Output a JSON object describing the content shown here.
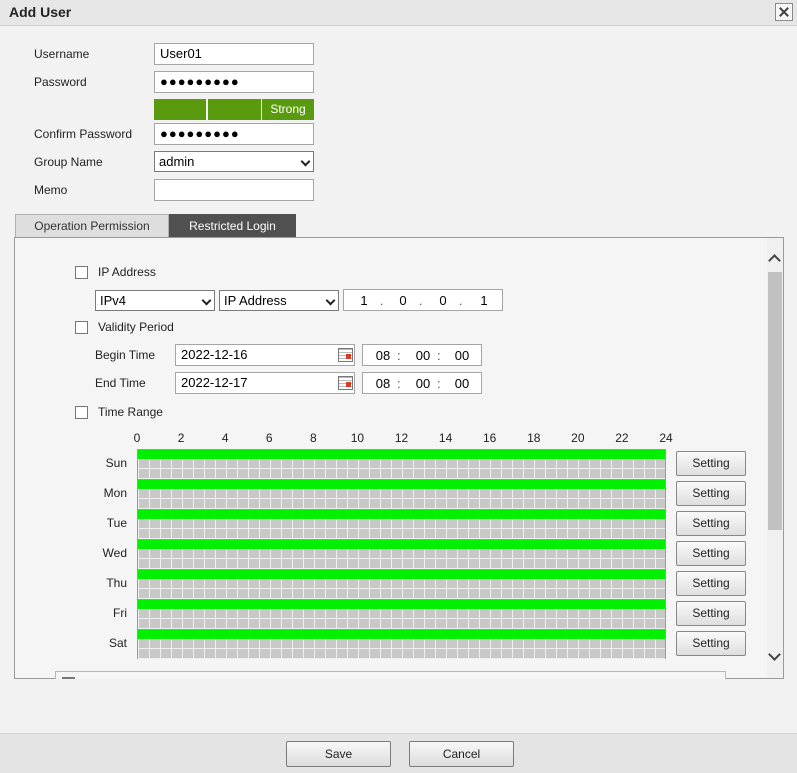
{
  "dialog": {
    "title": "Add User"
  },
  "form": {
    "username_label": "Username",
    "username_value": "User01",
    "password_label": "Password",
    "password_value": "●●●●●●●●●",
    "strength_label": "Strong",
    "confirm_label": "Confirm Password",
    "confirm_value": "●●●●●●●●●",
    "group_label": "Group Name",
    "group_value": "admin",
    "memo_label": "Memo",
    "memo_value": ""
  },
  "tabs": [
    {
      "label": "Operation Permission",
      "active": false
    },
    {
      "label": "Restricted Login",
      "active": true
    }
  ],
  "restricted": {
    "ip_address_label": "IP Address",
    "ip_version": "IPv4",
    "ip_mode": "IP Address",
    "ip_octets": [
      "1",
      "0",
      "0",
      "1"
    ],
    "validity_label": "Validity Period",
    "begin_label": "Begin Time",
    "begin_date": "2022-12-16",
    "begin_time": [
      "08",
      "00",
      "00"
    ],
    "end_label": "End Time",
    "end_date": "2022-12-17",
    "end_time": [
      "08",
      "00",
      "00"
    ],
    "time_range_label": "Time Range",
    "hours": [
      "0",
      "2",
      "4",
      "6",
      "8",
      "10",
      "12",
      "14",
      "16",
      "18",
      "20",
      "22",
      "24"
    ],
    "days": [
      "Sun",
      "Mon",
      "Tue",
      "Wed",
      "Thu",
      "Fri",
      "Sat"
    ],
    "setting_label": "Setting"
  },
  "footer": {
    "save_label": "Save",
    "cancel_label": "Cancel"
  },
  "colors": {
    "strength": "#5a9a0e",
    "timeline": "#00f000",
    "active_tab": "#505050"
  }
}
